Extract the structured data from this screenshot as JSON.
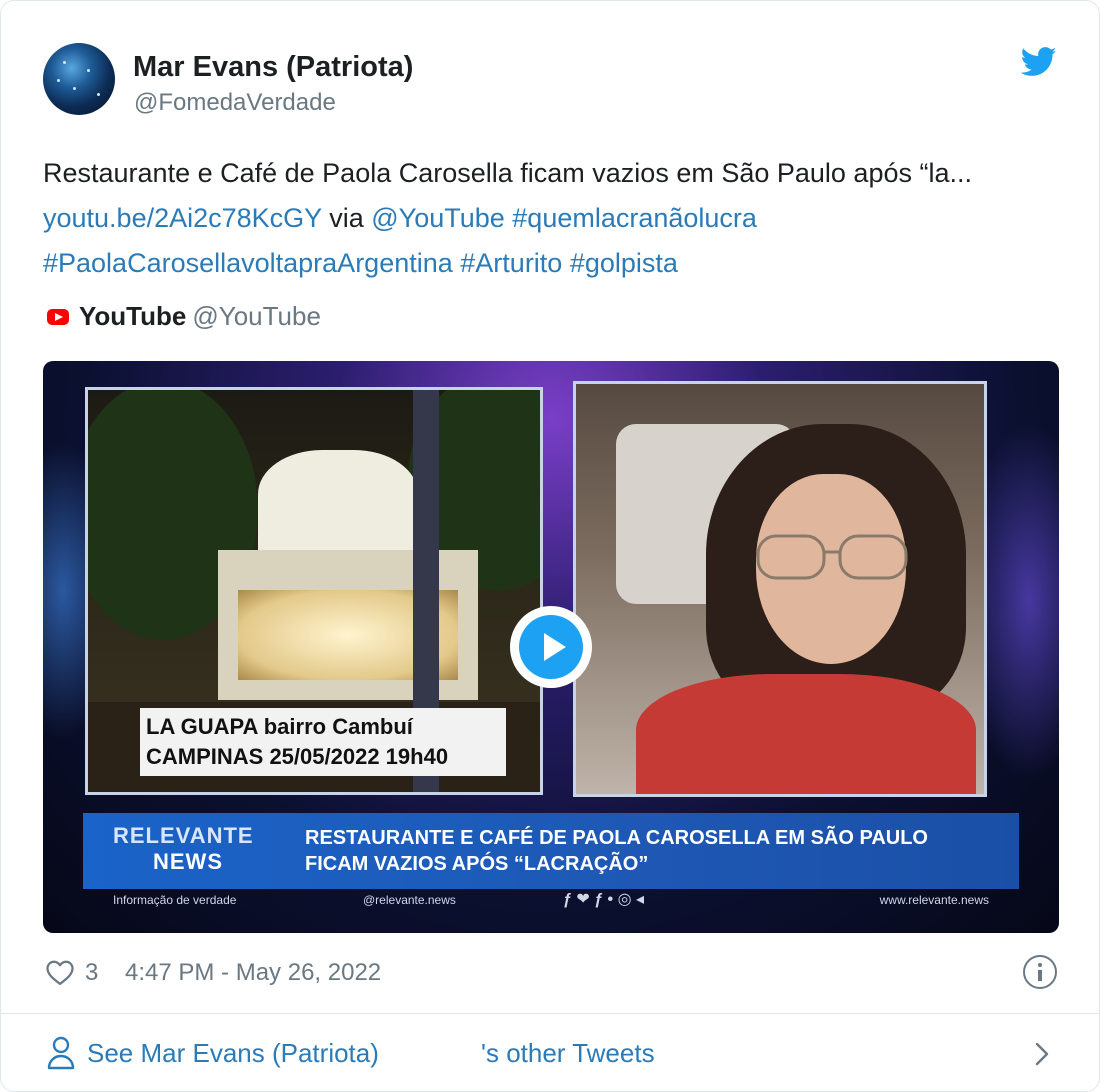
{
  "author": {
    "name": "Mar Evans (Patriota)",
    "handle": "@FomedaVerdade"
  },
  "tweet": {
    "text_plain_1": "Restaurante e Café de Paola Carosella ficam vazios em São Paulo após “la...",
    "link_url": "youtu.be/2Ai2c78KcGY",
    "text_via": "via",
    "mention": "@YouTube",
    "hashtags": [
      "#quemlacranãolucra",
      "#PaolaCarosellavoltapraArgentina",
      "#Arturito",
      "#golpista"
    ]
  },
  "quote_source": {
    "name": "YouTube",
    "handle": "@YouTube"
  },
  "media": {
    "caption_line_1": "LA GUAPA bairro Cambuí",
    "caption_line_2": "CAMPINAS 25/05/2022 19h40",
    "brand_line_1": "RELEVANTE",
    "brand_line_2": "NEWS",
    "headline_line_1": "RESTAURANTE E CAFÉ DE PAOLA CAROSELLA EM SÃO PAULO",
    "headline_line_2": "FICAM VAZIOS APÓS “LACRAÇÃO”",
    "footer_left": "Informação de verdade",
    "footer_mid": "@relevante.news",
    "footer_icons": "ƒ ❤ ƒ • ◎ ◂",
    "footer_right": "www.relevante.news"
  },
  "meta": {
    "like_count": "3",
    "timestamp": "4:47 PM - May 26, 2022"
  },
  "footer": {
    "see_text_1": "See Mar Evans (Patriota)",
    "see_text_2": "'s other Tweets"
  },
  "colors": {
    "link": "#2b7bb9",
    "secondary_text": "#697882",
    "twitter_blue": "#1da1f2",
    "youtube_red": "#ff0000"
  },
  "icons": [
    "twitter-bird-icon",
    "youtube-icon",
    "play-icon",
    "heart-icon",
    "info-icon",
    "person-icon",
    "chevron-right-icon"
  ]
}
